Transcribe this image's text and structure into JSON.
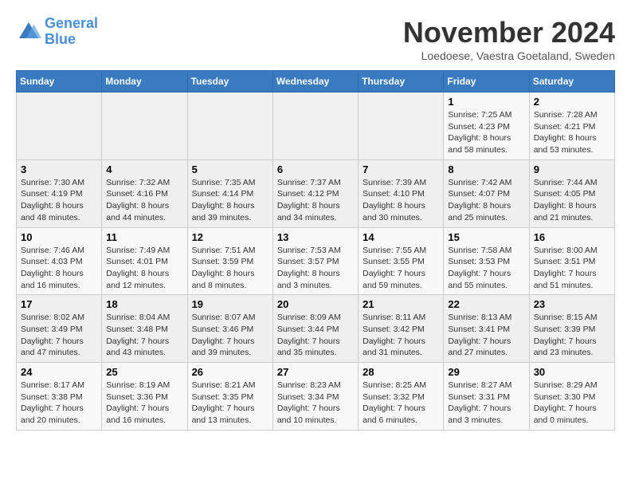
{
  "header": {
    "logo_line1": "General",
    "logo_line2": "Blue",
    "month": "November 2024",
    "location": "Loedoese, Vaestra Goetaland, Sweden"
  },
  "weekdays": [
    "Sunday",
    "Monday",
    "Tuesday",
    "Wednesday",
    "Thursday",
    "Friday",
    "Saturday"
  ],
  "weeks": [
    [
      {
        "day": "",
        "info": ""
      },
      {
        "day": "",
        "info": ""
      },
      {
        "day": "",
        "info": ""
      },
      {
        "day": "",
        "info": ""
      },
      {
        "day": "",
        "info": ""
      },
      {
        "day": "1",
        "info": "Sunrise: 7:25 AM\nSunset: 4:23 PM\nDaylight: 8 hours\nand 58 minutes."
      },
      {
        "day": "2",
        "info": "Sunrise: 7:28 AM\nSunset: 4:21 PM\nDaylight: 8 hours\nand 53 minutes."
      }
    ],
    [
      {
        "day": "3",
        "info": "Sunrise: 7:30 AM\nSunset: 4:19 PM\nDaylight: 8 hours\nand 48 minutes."
      },
      {
        "day": "4",
        "info": "Sunrise: 7:32 AM\nSunset: 4:16 PM\nDaylight: 8 hours\nand 44 minutes."
      },
      {
        "day": "5",
        "info": "Sunrise: 7:35 AM\nSunset: 4:14 PM\nDaylight: 8 hours\nand 39 minutes."
      },
      {
        "day": "6",
        "info": "Sunrise: 7:37 AM\nSunset: 4:12 PM\nDaylight: 8 hours\nand 34 minutes."
      },
      {
        "day": "7",
        "info": "Sunrise: 7:39 AM\nSunset: 4:10 PM\nDaylight: 8 hours\nand 30 minutes."
      },
      {
        "day": "8",
        "info": "Sunrise: 7:42 AM\nSunset: 4:07 PM\nDaylight: 8 hours\nand 25 minutes."
      },
      {
        "day": "9",
        "info": "Sunrise: 7:44 AM\nSunset: 4:05 PM\nDaylight: 8 hours\nand 21 minutes."
      }
    ],
    [
      {
        "day": "10",
        "info": "Sunrise: 7:46 AM\nSunset: 4:03 PM\nDaylight: 8 hours\nand 16 minutes."
      },
      {
        "day": "11",
        "info": "Sunrise: 7:49 AM\nSunset: 4:01 PM\nDaylight: 8 hours\nand 12 minutes."
      },
      {
        "day": "12",
        "info": "Sunrise: 7:51 AM\nSunset: 3:59 PM\nDaylight: 8 hours\nand 8 minutes."
      },
      {
        "day": "13",
        "info": "Sunrise: 7:53 AM\nSunset: 3:57 PM\nDaylight: 8 hours\nand 3 minutes."
      },
      {
        "day": "14",
        "info": "Sunrise: 7:55 AM\nSunset: 3:55 PM\nDaylight: 7 hours\nand 59 minutes."
      },
      {
        "day": "15",
        "info": "Sunrise: 7:58 AM\nSunset: 3:53 PM\nDaylight: 7 hours\nand 55 minutes."
      },
      {
        "day": "16",
        "info": "Sunrise: 8:00 AM\nSunset: 3:51 PM\nDaylight: 7 hours\nand 51 minutes."
      }
    ],
    [
      {
        "day": "17",
        "info": "Sunrise: 8:02 AM\nSunset: 3:49 PM\nDaylight: 7 hours\nand 47 minutes."
      },
      {
        "day": "18",
        "info": "Sunrise: 8:04 AM\nSunset: 3:48 PM\nDaylight: 7 hours\nand 43 minutes."
      },
      {
        "day": "19",
        "info": "Sunrise: 8:07 AM\nSunset: 3:46 PM\nDaylight: 7 hours\nand 39 minutes."
      },
      {
        "day": "20",
        "info": "Sunrise: 8:09 AM\nSunset: 3:44 PM\nDaylight: 7 hours\nand 35 minutes."
      },
      {
        "day": "21",
        "info": "Sunrise: 8:11 AM\nSunset: 3:42 PM\nDaylight: 7 hours\nand 31 minutes."
      },
      {
        "day": "22",
        "info": "Sunrise: 8:13 AM\nSunset: 3:41 PM\nDaylight: 7 hours\nand 27 minutes."
      },
      {
        "day": "23",
        "info": "Sunrise: 8:15 AM\nSunset: 3:39 PM\nDaylight: 7 hours\nand 23 minutes."
      }
    ],
    [
      {
        "day": "24",
        "info": "Sunrise: 8:17 AM\nSunset: 3:38 PM\nDaylight: 7 hours\nand 20 minutes."
      },
      {
        "day": "25",
        "info": "Sunrise: 8:19 AM\nSunset: 3:36 PM\nDaylight: 7 hours\nand 16 minutes."
      },
      {
        "day": "26",
        "info": "Sunrise: 8:21 AM\nSunset: 3:35 PM\nDaylight: 7 hours\nand 13 minutes."
      },
      {
        "day": "27",
        "info": "Sunrise: 8:23 AM\nSunset: 3:34 PM\nDaylight: 7 hours\nand 10 minutes."
      },
      {
        "day": "28",
        "info": "Sunrise: 8:25 AM\nSunset: 3:32 PM\nDaylight: 7 hours\nand 6 minutes."
      },
      {
        "day": "29",
        "info": "Sunrise: 8:27 AM\nSunset: 3:31 PM\nDaylight: 7 hours\nand 3 minutes."
      },
      {
        "day": "30",
        "info": "Sunrise: 8:29 AM\nSunset: 3:30 PM\nDaylight: 7 hours\nand 0 minutes."
      }
    ]
  ]
}
